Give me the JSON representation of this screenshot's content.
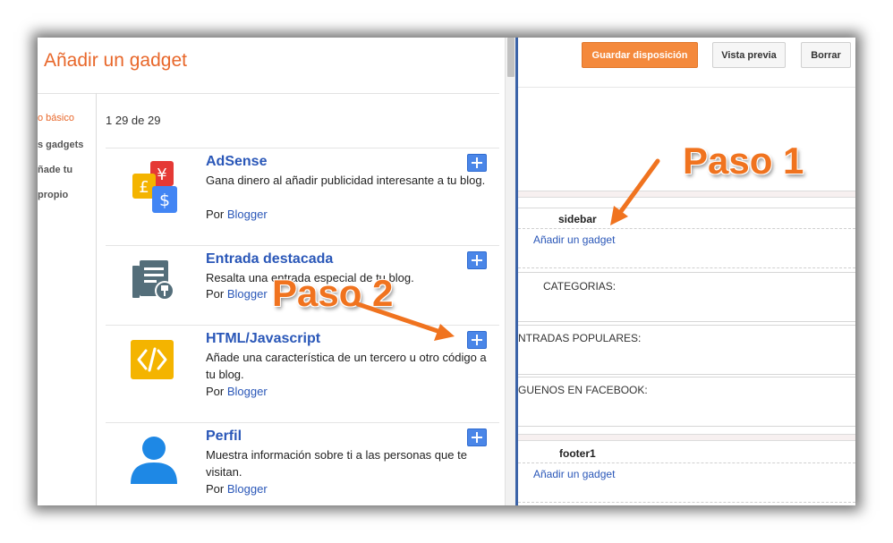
{
  "dialog": {
    "title": "Añadir un gadget",
    "categories": [
      {
        "label": "o básico",
        "active": true
      },
      {
        "label": "s gadgets",
        "active": false
      },
      {
        "label": "ñade tu",
        "active": false
      },
      {
        "label": "propio",
        "active": false
      }
    ],
    "result_count": "1 29 de 29",
    "gadgets": [
      {
        "name": "AdSense",
        "desc": "Gana dinero al añadir publicidad interesante a tu blog.",
        "by": "Por",
        "author": "Blogger",
        "icon": "adsense-currency-icon"
      },
      {
        "name": "Entrada destacada",
        "desc": "Resalta una entrada especial de tu blog.",
        "by": "Por",
        "author": "Blogger",
        "icon": "featured-post-icon"
      },
      {
        "name": "HTML/Javascript",
        "desc": "Añade una característica de un tercero u otro código a tu blog.",
        "by": "Por",
        "author": "Blogger",
        "icon": "code-brackets-icon"
      },
      {
        "name": "Perfil",
        "desc": "Muestra información sobre ti a las personas que te visitan.",
        "by": "Por",
        "author": "Blogger",
        "icon": "person-icon"
      }
    ]
  },
  "layout": {
    "toolbar": {
      "save_label": "Guardar disposición",
      "preview_label": "Vista previa",
      "delete_label": "Borrar"
    },
    "sidebar": {
      "title": "sidebar",
      "add_link": "Añadir un gadget"
    },
    "widgets": [
      "CATEGORIAS:",
      "NTRADAS POPULARES:",
      "GUENOS EN FACEBOOK:"
    ],
    "footer": {
      "title": "footer1",
      "add_link": "Añadir un gadget"
    }
  },
  "annotations": {
    "step1": "Paso 1",
    "step2": "Paso 2"
  },
  "colors": {
    "accent_orange": "#e8672a",
    "annotation_orange": "#f0731f",
    "link_blue": "#2a57b8",
    "add_button_blue": "#4a86e8",
    "save_button": "#f4893c"
  }
}
